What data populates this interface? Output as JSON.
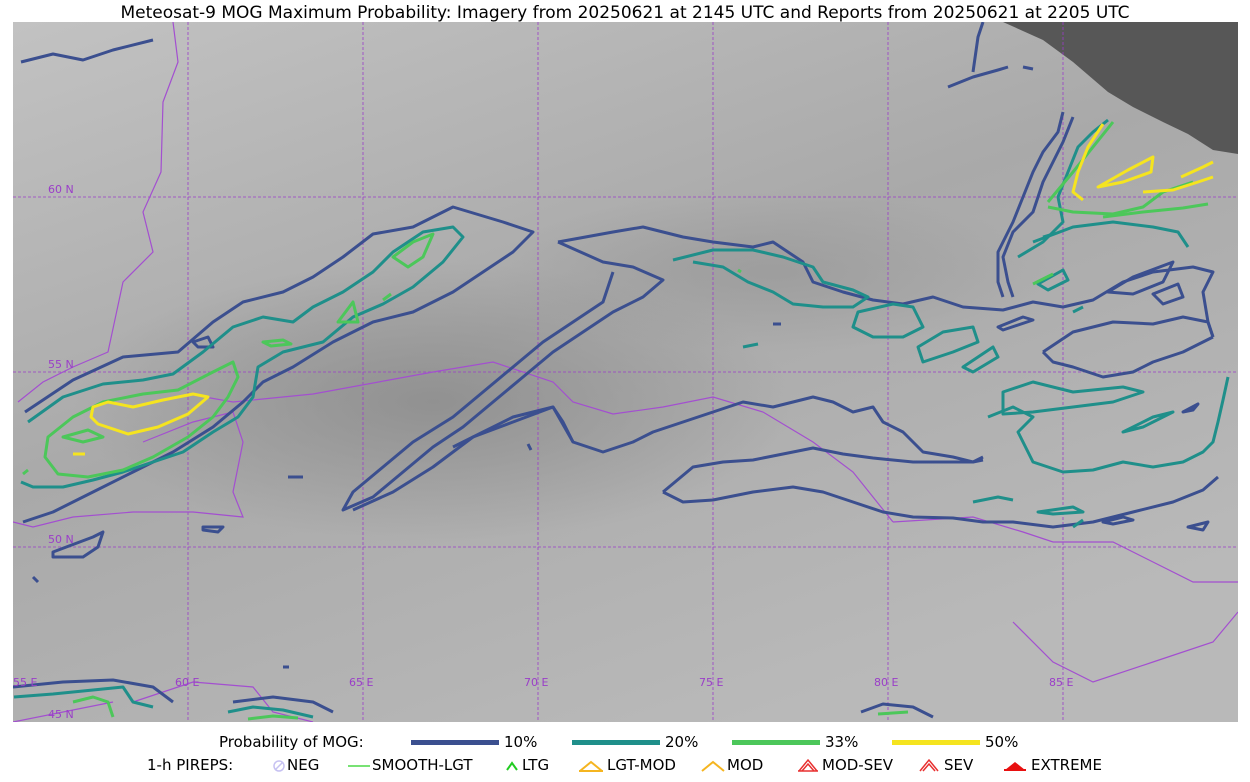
{
  "title": "Meteosat-9 MOG Maximum Probability: Imagery from 20250621 at 2145 UTC and Reports from 20250621 at 2205 UTC",
  "map": {
    "latitude_labels": [
      "60 N",
      "55 N",
      "50 N",
      "45 N"
    ],
    "longitude_labels": [
      "55 E",
      "60 E",
      "65 E",
      "70 E",
      "75 E",
      "80 E",
      "85 E"
    ],
    "gridline_color": "#9a3ec8",
    "border_color": "#a34fd0"
  },
  "legend": {
    "probability_title": "Probability of MOG:",
    "probability_levels": [
      {
        "label": "10%",
        "color": "#3b4f8f"
      },
      {
        "label": "20%",
        "color": "#1f8f8a"
      },
      {
        "label": "33%",
        "color": "#4cc75a"
      },
      {
        "label": "50%",
        "color": "#f5e41f"
      }
    ],
    "pireps_title": "1-h PIREPS:",
    "pireps": [
      {
        "label": "NEG",
        "icon": "neg-icon",
        "color": "#c7c2f2"
      },
      {
        "label": "SMOOTH-LGT",
        "icon": "smooth-lgt-line-icon",
        "color": "#4cd846"
      },
      {
        "label": "LTG",
        "icon": "ltg-chevron-icon",
        "color": "#22cc22"
      },
      {
        "label": "LGT-MOD",
        "icon": "lgt-mod-icon",
        "color": "#f5b520"
      },
      {
        "label": "MOD",
        "icon": "mod-icon",
        "color": "#f5b520"
      },
      {
        "label": "MOD-SEV",
        "icon": "mod-sev-icon",
        "color": "#e83030"
      },
      {
        "label": "SEV",
        "icon": "sev-icon",
        "color": "#e83030"
      },
      {
        "label": "EXTREME",
        "icon": "extreme-icon",
        "color": "#e81010"
      }
    ]
  }
}
